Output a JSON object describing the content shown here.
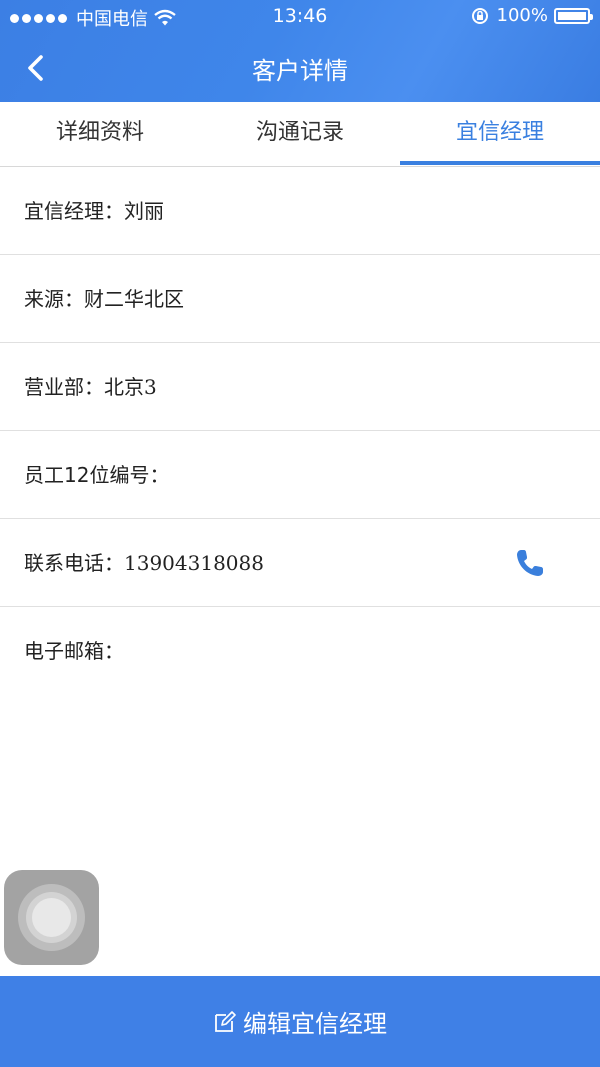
{
  "status_bar": {
    "carrier": "中国电信",
    "time": "13:46",
    "battery": "100%"
  },
  "navbar": {
    "title": "客户详情"
  },
  "tabs": [
    {
      "label": "详细资料",
      "active": false
    },
    {
      "label": "沟通记录",
      "active": false
    },
    {
      "label": "宜信经理",
      "active": true
    }
  ],
  "details": {
    "manager_label": "宜信经理：",
    "manager_value": "刘丽",
    "source_label": "来源：",
    "source_value": "财二华北区",
    "department_label": "营业部：",
    "department_value": "北京3",
    "employee_id_label": "员工12位编号：",
    "employee_id_value": "",
    "phone_label": "联系电话：",
    "phone_value": "13904318088",
    "email_label": "电子邮箱：",
    "email_value": ""
  },
  "bottom_button": {
    "label": "编辑宜信经理"
  },
  "colors": {
    "accent": "#3a80e0",
    "header": "#3f86ea",
    "divider": "#e0e0e0"
  }
}
